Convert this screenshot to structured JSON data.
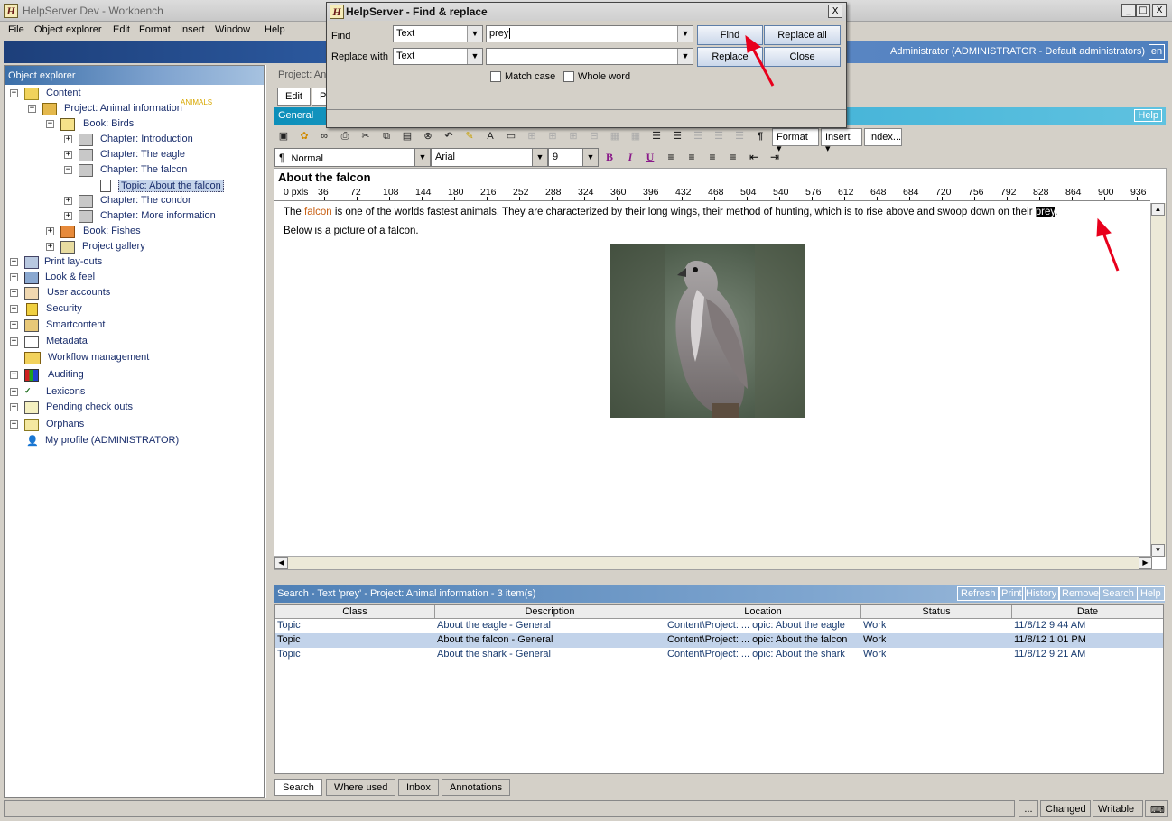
{
  "window": {
    "title": "HelpServer Dev - Workbench",
    "min": "_",
    "max": "□",
    "close": "X"
  },
  "menu": [
    "File",
    "Object explorer",
    "Edit",
    "Format",
    "Insert",
    "Window",
    "Help"
  ],
  "banner": {
    "user": "Administrator (ADMINISTRATOR - Default administrators)",
    "lang": "en"
  },
  "explorer": {
    "title": "Object explorer",
    "items": [
      {
        "label": "Content"
      },
      {
        "label": "Project: Animal information",
        "tag": "ANIMALS"
      },
      {
        "label": "Book: Birds"
      },
      {
        "label": "Chapter: Introduction"
      },
      {
        "label": "Chapter: The eagle"
      },
      {
        "label": "Chapter: The falcon"
      },
      {
        "label": "Topic: About the falcon"
      },
      {
        "label": "Chapter: The condor"
      },
      {
        "label": "Chapter: More information"
      },
      {
        "label": "Book: Fishes"
      },
      {
        "label": "Project gallery"
      },
      {
        "label": "Print lay-outs"
      },
      {
        "label": "Look & feel"
      },
      {
        "label": "User accounts"
      },
      {
        "label": "Security"
      },
      {
        "label": "Smartcontent"
      },
      {
        "label": "Metadata"
      },
      {
        "label": "Workflow management"
      },
      {
        "label": "Auditing"
      },
      {
        "label": "Lexicons"
      },
      {
        "label": "Pending check outs"
      },
      {
        "label": "Orphans"
      },
      {
        "label": "My profile (ADMINISTRATOR)"
      }
    ]
  },
  "project_bar": "Project: An",
  "tabs": {
    "edit": "Edit",
    "p": "P"
  },
  "general": {
    "label": "General",
    "help": "Help"
  },
  "toolbar": {
    "format": "Format",
    "insert": "Insert",
    "index": "Index..."
  },
  "format_bar": {
    "style": "Normal",
    "font": "Arial",
    "size": "9",
    "bold": "B",
    "italic": "I",
    "underline": "U"
  },
  "editor": {
    "title": "About the falcon",
    "ruler": [
      "0 pxls",
      "36",
      "72",
      "108",
      "144",
      "180",
      "216",
      "252",
      "288",
      "324",
      "360",
      "396",
      "432",
      "468",
      "504",
      "540",
      "576",
      "612",
      "648",
      "684",
      "720",
      "756",
      "792",
      "828",
      "864",
      "900",
      "936"
    ],
    "p1_before": "The ",
    "p1_highlight": "falcon",
    "p1_middle": " is one of the worlds fastest animals. They are characterized by their long wings, their method of hunting, which is to rise above and swoop down on their ",
    "p1_found": "prey",
    "p1_after": ".",
    "p2": "Below is a picture of a falcon."
  },
  "search": {
    "header": "Search - Text 'prey' - Project: Animal information - 3 item(s)",
    "buttons": [
      "Refresh",
      "Print",
      "History",
      "Remove",
      "Search",
      "Help"
    ],
    "columns": [
      "Class",
      "Description",
      "Location",
      "Status",
      "Date"
    ],
    "rows": [
      [
        "Topic",
        "About the eagle - General",
        "Content\\Project:  ... opic: About the eagle",
        "Work",
        "11/8/12 9:44 AM"
      ],
      [
        "Topic",
        "About the falcon - General",
        "Content\\Project:  ... opic: About the falcon",
        "Work",
        "11/8/12 1:01 PM"
      ],
      [
        "Topic",
        "About the shark - General",
        "Content\\Project:  ... opic: About the shark",
        "Work",
        "11/8/12 9:21 AM"
      ]
    ]
  },
  "bottom_tabs": [
    "Search",
    "Where used",
    "Inbox",
    "Annotations"
  ],
  "status": {
    "more": "...",
    "changed": "Changed",
    "writable": "Writable"
  },
  "dialog": {
    "title": "HelpServer - Find & replace",
    "find_label": "Find",
    "replace_label": "Replace with",
    "find_type": "Text",
    "replace_type": "Text",
    "find_value": "prey",
    "replace_value": "",
    "match_case": "Match case",
    "whole_word": "Whole word",
    "btn_find": "Find",
    "btn_replace_all": "Replace all",
    "btn_replace": "Replace",
    "btn_close": "Close"
  },
  "colors": {
    "accent_annotation": "#e8001c",
    "highlight_word": "#c86014"
  }
}
